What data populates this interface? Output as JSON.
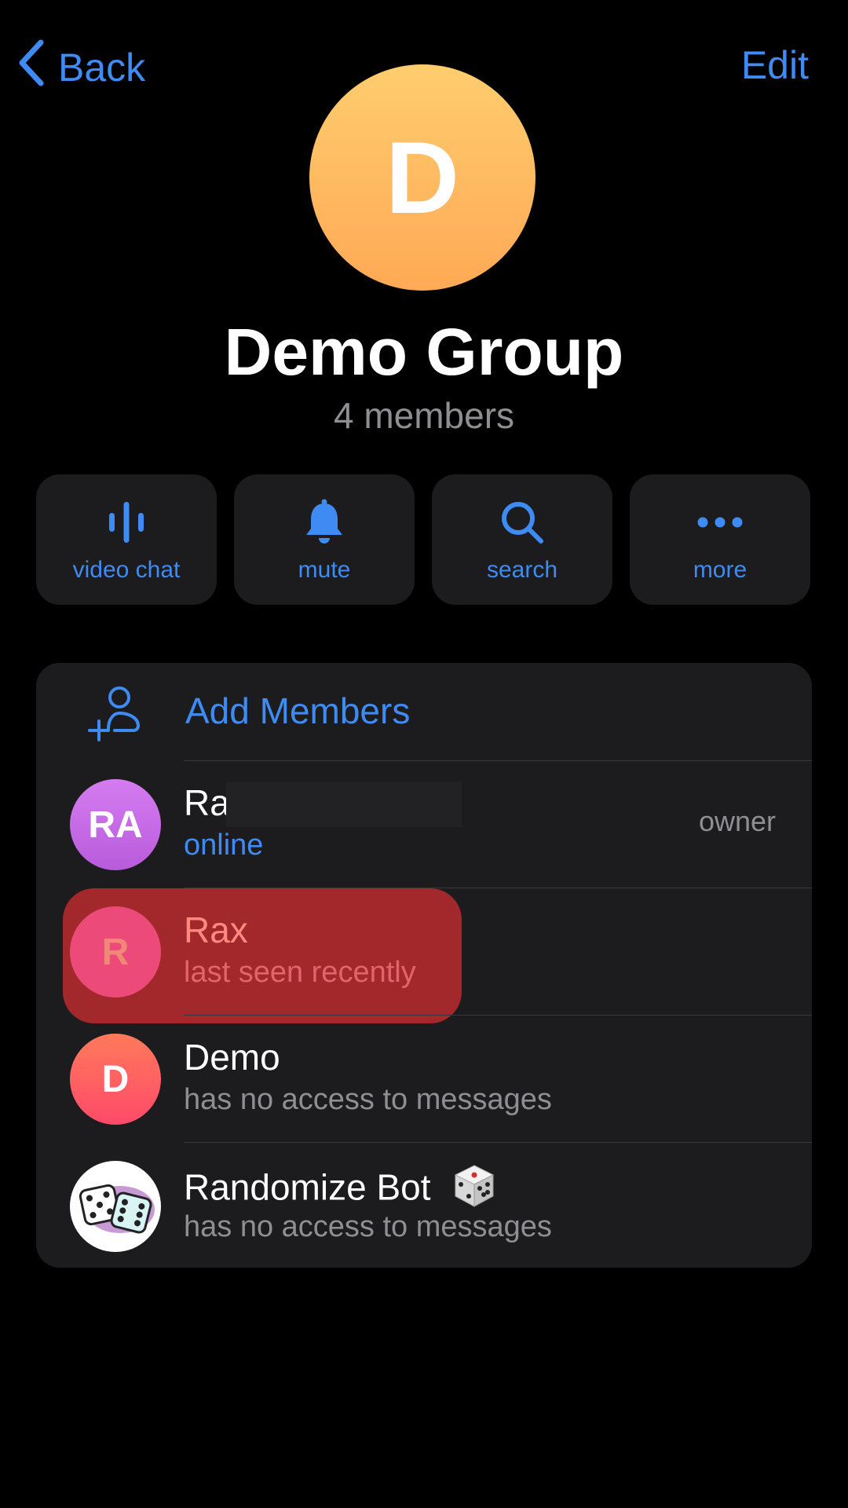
{
  "nav": {
    "back_label": "Back",
    "edit_label": "Edit"
  },
  "group": {
    "avatar_letter": "D",
    "title": "Demo Group",
    "subtitle": "4 members"
  },
  "actions": [
    {
      "label": "video chat",
      "icon": "voice-wave-icon"
    },
    {
      "label": "mute",
      "icon": "bell-icon"
    },
    {
      "label": "search",
      "icon": "search-icon"
    },
    {
      "label": "more",
      "icon": "more-dots-icon"
    }
  ],
  "members_section": {
    "add_label": "Add Members",
    "members": [
      {
        "initials": "RA",
        "name": "Ra",
        "status": "online",
        "role": "owner",
        "avatar_color": "#c86ee0"
      },
      {
        "initials": "R",
        "name": "Rax",
        "status": "last seen recently",
        "role": "",
        "avatar_color": "#ec4a78"
      },
      {
        "initials": "D",
        "name": "Demo",
        "status": "has no access to messages",
        "role": "",
        "avatar_color": "#ff5a5a"
      },
      {
        "initials": "",
        "name": "Randomize Bot",
        "status": "has no access to messages",
        "role": "",
        "avatar_color": "#ffffff"
      }
    ]
  },
  "colors": {
    "accent": "#3e8bf3",
    "card_bg": "#1c1c1e",
    "highlight": "#a3282c",
    "group_avatar": "#ffb95f"
  }
}
